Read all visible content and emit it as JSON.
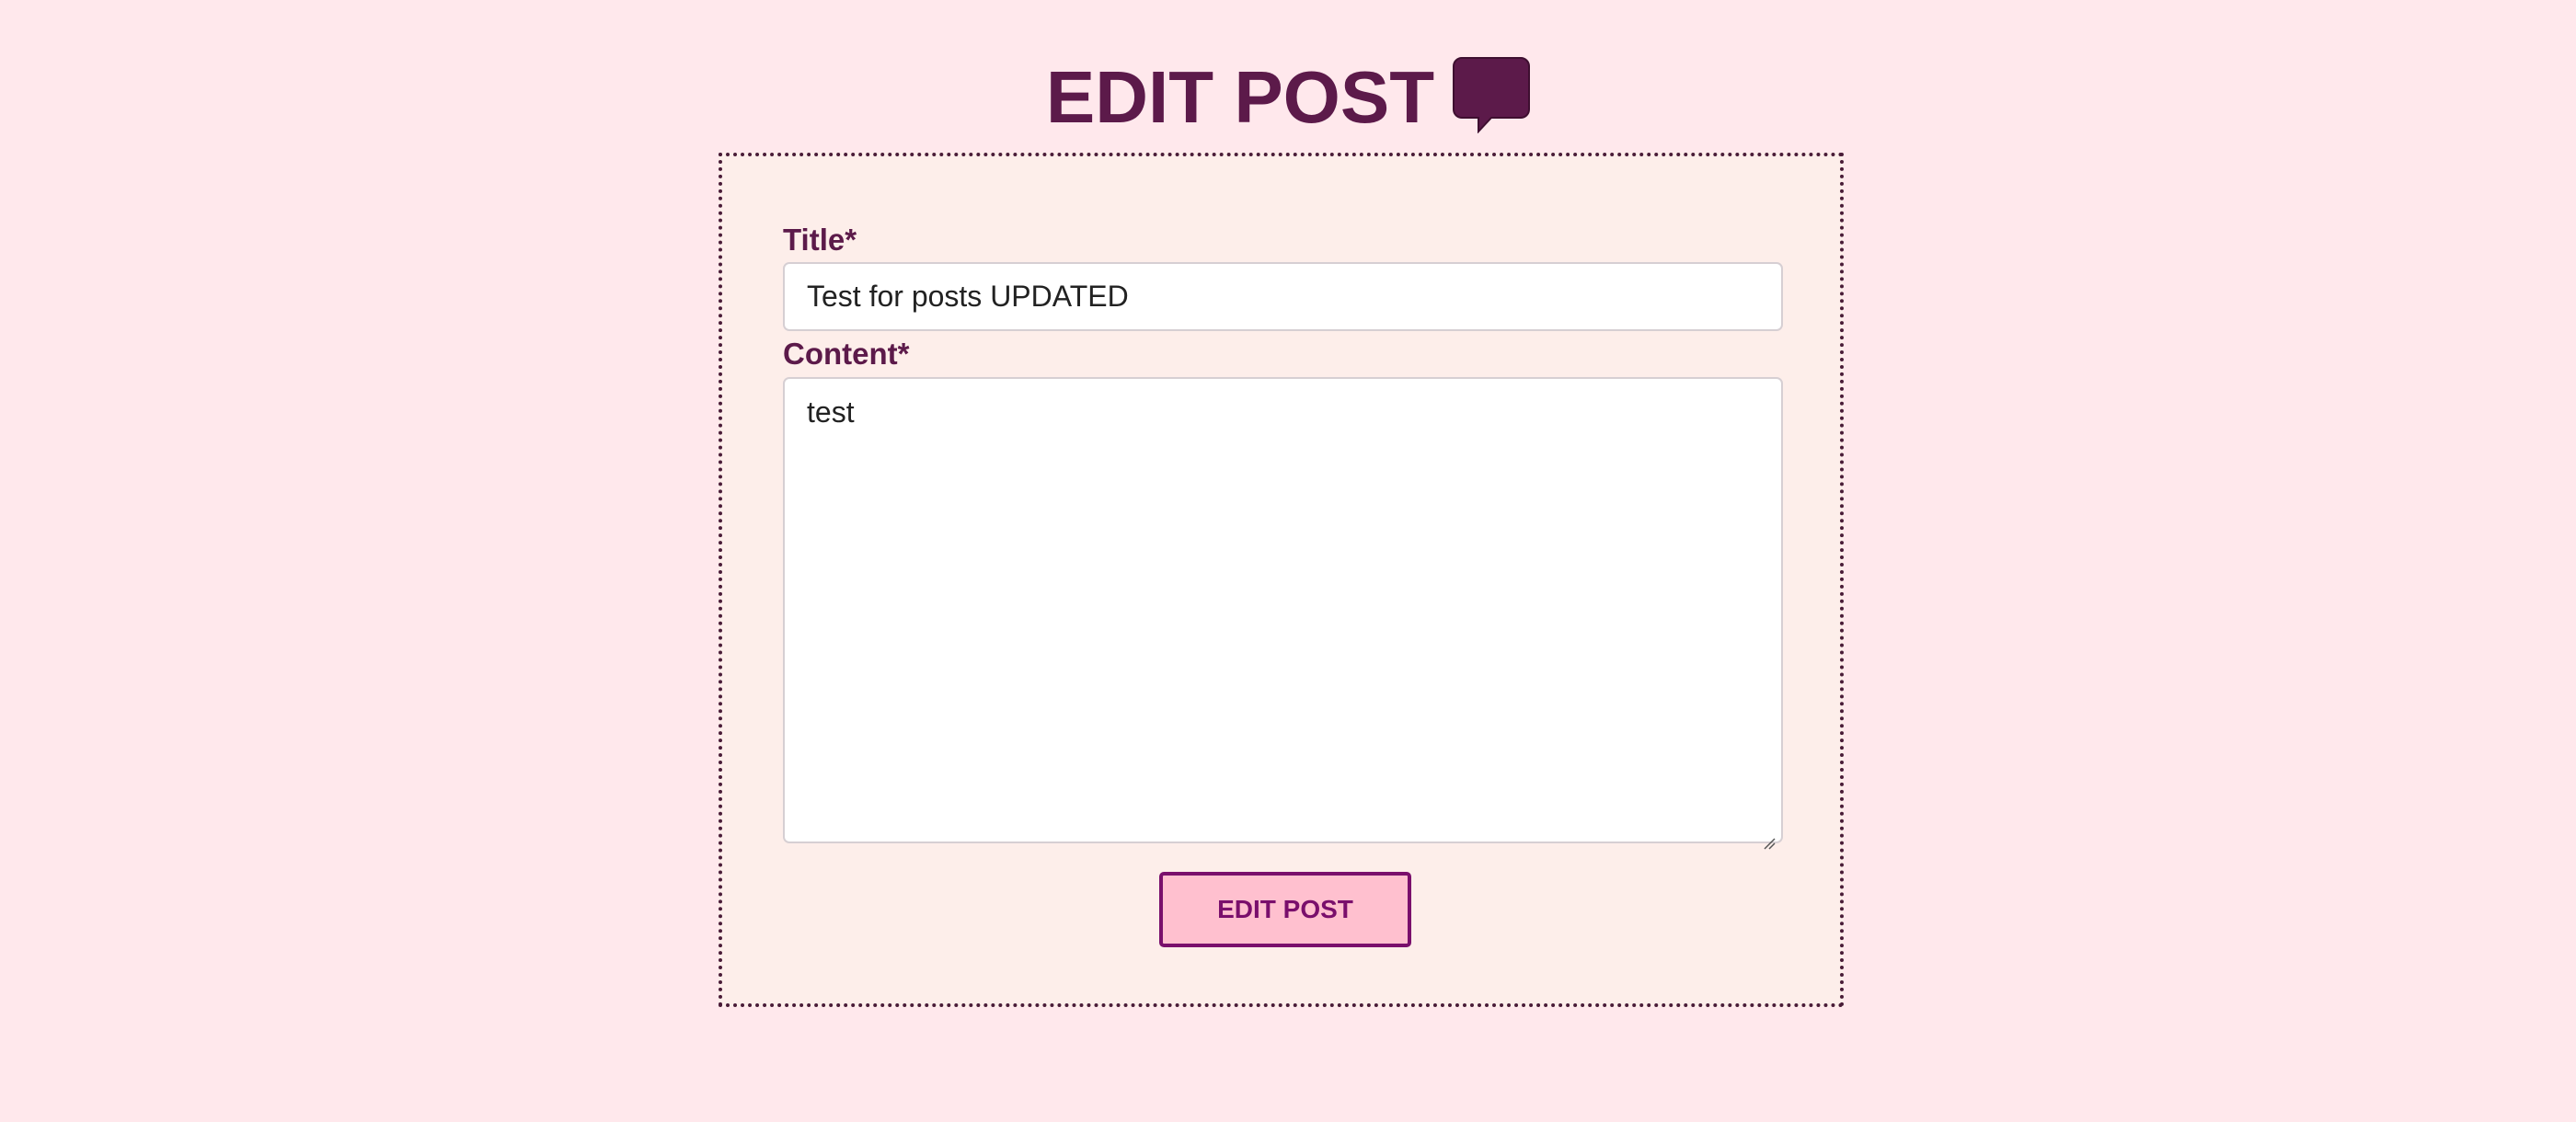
{
  "page": {
    "heading": "EDIT POST",
    "heading_icon": "speech-bubble-icon"
  },
  "form": {
    "title_label": "Title*",
    "title_value": "Test for posts UPDATED",
    "content_label": "Content*",
    "content_value": "test",
    "submit_label": "EDIT POST"
  },
  "colors": {
    "background": "#ffe8ec",
    "card_background": "#fdeeea",
    "heading": "#5c1a4a",
    "button_fill": "#ffc0cf",
    "button_border": "#7a0f6c"
  }
}
